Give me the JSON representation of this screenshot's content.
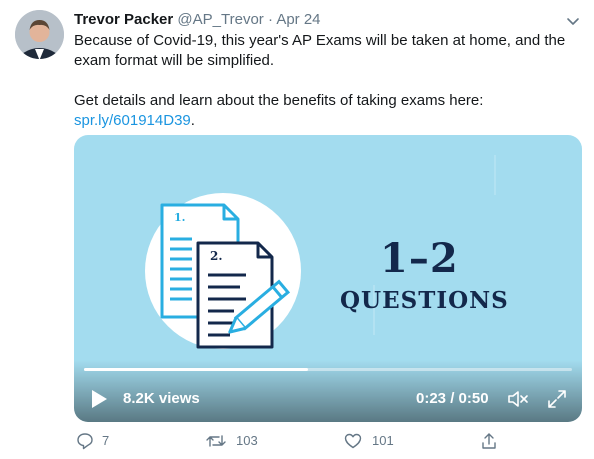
{
  "tweet": {
    "author_name": "Trevor Packer",
    "handle": "@AP_Trevor",
    "separator": "·",
    "date": "Apr 24",
    "text_line1": "Because of Covid-19, this year's AP Exams will be taken at home, and the",
    "text_line2": "exam format will be simplified.",
    "text_line3": "Get details and learn about the benefits of taking exams here:",
    "link": "spr.ly/601914D39",
    "link_suffix": "."
  },
  "video": {
    "heading_number": "1–2",
    "heading_word": "QUESTIONS",
    "doc_label_1": "1.",
    "doc_label_2": "2.",
    "views": "8.2K views",
    "time": "0:23 / 0:50",
    "progress_fraction": 0.46
  },
  "actions": {
    "replies": "7",
    "retweets": "103",
    "likes": "101"
  },
  "colors": {
    "link": "#1b95e0",
    "video_bg": "#a3dcef",
    "heading": "#13284b",
    "muted_text": "#657786"
  },
  "icons": [
    "chevron-down-icon",
    "play-icon",
    "mute-icon",
    "fullscreen-icon",
    "reply-icon",
    "retweet-icon",
    "like-icon",
    "share-icon"
  ]
}
